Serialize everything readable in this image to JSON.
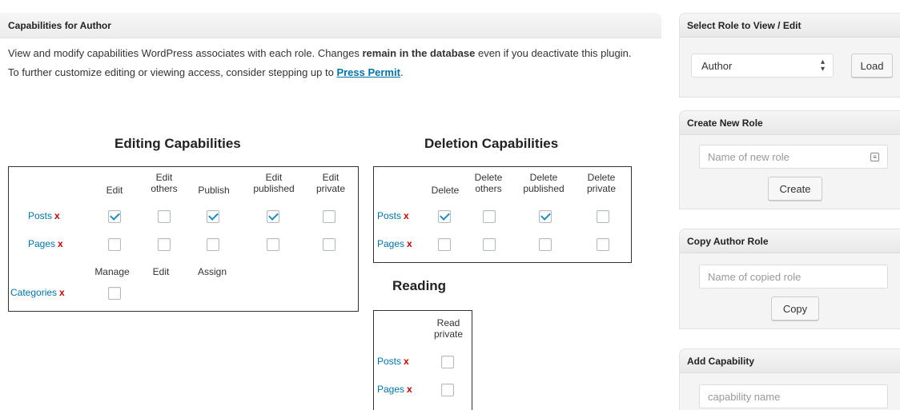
{
  "main": {
    "header": "Capabilities for Author",
    "intro_line1_a": "View and modify capabilities WordPress associates with each role. Changes ",
    "intro_line1_bold": "remain in the database",
    "intro_line1_b": " even if you deactivate this plugin.",
    "intro_line2_a": "To further customize editing or viewing access, consider stepping up to ",
    "intro_link": "Press Permit",
    "intro_line2_b": "."
  },
  "editing": {
    "title": "Editing Capabilities",
    "columns": [
      "Edit",
      "Edit others",
      "Publish",
      "Edit published",
      "Edit private"
    ],
    "rows": [
      {
        "label": "Posts",
        "remove": "x",
        "checks": [
          true,
          false,
          true,
          true,
          false
        ]
      },
      {
        "label": "Pages",
        "remove": "x",
        "checks": [
          false,
          false,
          false,
          false,
          false
        ]
      }
    ],
    "tax_columns": [
      "Manage",
      "Edit",
      "Assign"
    ],
    "tax_rows": [
      {
        "label": "Categories",
        "remove": "x",
        "checks": [
          false
        ]
      }
    ]
  },
  "deletion": {
    "title": "Deletion Capabilities",
    "columns": [
      "Delete",
      "Delete others",
      "Delete published",
      "Delete private"
    ],
    "rows": [
      {
        "label": "Posts",
        "remove": "x",
        "checks": [
          true,
          false,
          true,
          false
        ]
      },
      {
        "label": "Pages",
        "remove": "x",
        "checks": [
          false,
          false,
          false,
          false
        ]
      }
    ]
  },
  "reading": {
    "title": "Reading",
    "columns": [
      "Read private"
    ],
    "rows": [
      {
        "label": "Posts",
        "remove": "x",
        "checks": [
          false
        ]
      },
      {
        "label": "Pages",
        "remove": "x",
        "checks": [
          false
        ]
      }
    ]
  },
  "sidebar": {
    "select_role": {
      "header": "Select Role to View / Edit",
      "selected": "Author",
      "button": "Load"
    },
    "create_role": {
      "header": "Create New Role",
      "placeholder": "Name of new role",
      "button": "Create"
    },
    "copy_role": {
      "header": "Copy Author Role",
      "placeholder": "Name of copied role",
      "button": "Copy"
    },
    "add_capability": {
      "header": "Add Capability",
      "placeholder": "capability name"
    }
  }
}
